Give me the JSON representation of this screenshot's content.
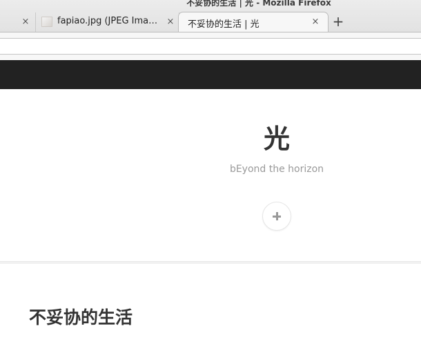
{
  "window": {
    "title": "不妥协的生活 | 光 - Mozilla Firefox"
  },
  "tabs": [
    {
      "label": "",
      "close": "×"
    },
    {
      "label": "fapiao.jpg (JPEG Ima…",
      "close": "×",
      "favicon": "image-thumbnail-icon"
    },
    {
      "label": "不妥协的生活 | 光",
      "close": "×",
      "active": true
    }
  ],
  "toolbar": {
    "new_tab_label": "+"
  },
  "site": {
    "title": "光",
    "tagline": "bEyond the horizon",
    "toggle_icon": "plus-icon",
    "navbar_color": "#222222"
  },
  "post": {
    "title": "不妥协的生活"
  }
}
